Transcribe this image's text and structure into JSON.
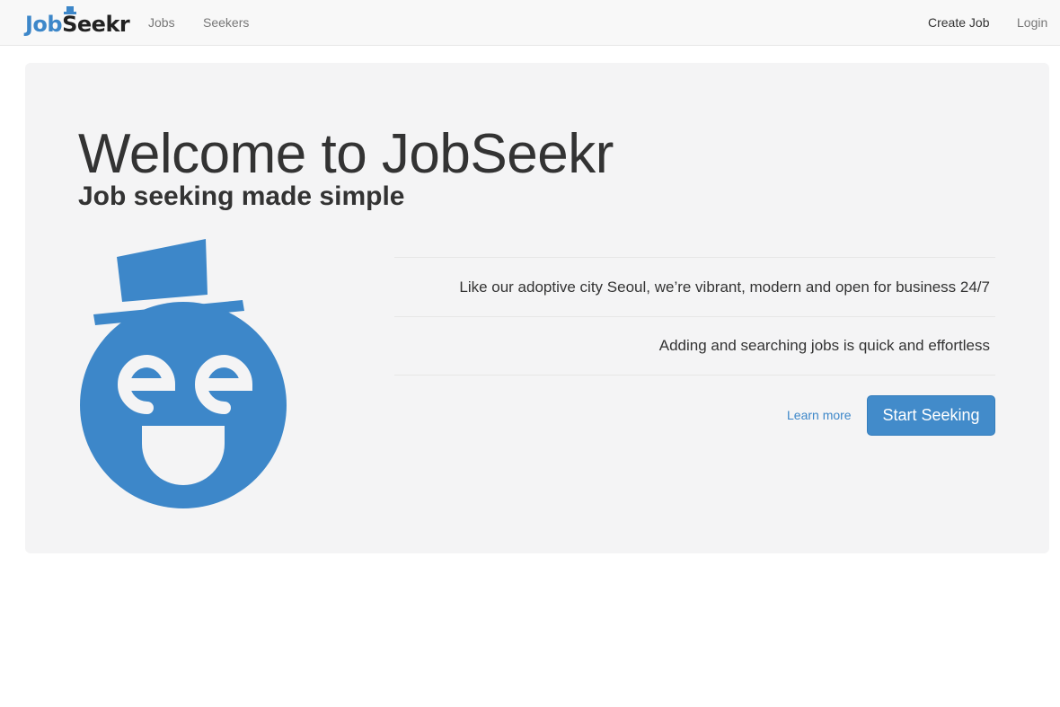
{
  "navbar": {
    "brand_part1": "Job",
    "brand_s": "S",
    "brand_part2": "eekr",
    "links": {
      "jobs": "Jobs",
      "seekers": "Seekers",
      "create_job": "Create Job",
      "login": "Login"
    }
  },
  "hero": {
    "title": "Welcome to JobSeekr",
    "subtitle": "Job seeking made simple",
    "features": [
      "Like our adoptive city Seoul, we’re vibrant, modern and open for business 24/7",
      "Adding and searching jobs is quick and effortless"
    ],
    "learn_more": "Learn more",
    "cta": "Start Seeking"
  },
  "colors": {
    "brand_blue": "#3d87c9",
    "navbar_bg": "#f8f8f8",
    "jumbotron_bg": "#f4f4f5",
    "button_bg": "#428bca"
  },
  "icons": {
    "logo": "top-hat-icon",
    "mascot": "smiling-face-top-hat-icon"
  }
}
